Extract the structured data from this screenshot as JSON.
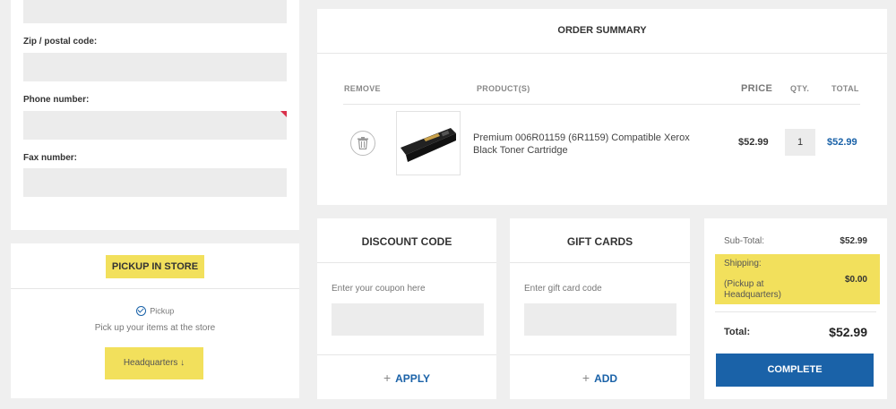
{
  "address_form": {
    "zip_label": "Zip / postal code:",
    "phone_label": "Phone number:",
    "fax_label": "Fax number:"
  },
  "pickup": {
    "title": "PICKUP IN STORE",
    "option_label": "Pickup",
    "description": "Pick up your items at the store",
    "store_button": "Headquarters ↓"
  },
  "order_summary": {
    "title": "ORDER SUMMARY",
    "headers": {
      "remove": "REMOVE",
      "products": "PRODUCT(S)",
      "price": "PRICE",
      "qty": "QTY.",
      "total": "TOTAL"
    },
    "item": {
      "name": "Premium 006R01159 (6R1159) Compatible Xerox Black Toner Cartridge",
      "price": "$52.99",
      "qty": "1",
      "total": "$52.99"
    }
  },
  "discount": {
    "title": "DISCOUNT CODE",
    "placeholder": "Enter your coupon here",
    "action": "APPLY"
  },
  "gift_cards": {
    "title": "GIFT CARDS",
    "placeholder": "Enter gift card code",
    "action": "ADD"
  },
  "totals": {
    "subtotal_label": "Sub-Total:",
    "subtotal_value": "$52.99",
    "shipping_label": "Shipping:",
    "shipping_note": "(Pickup at Headquarters)",
    "shipping_value": "$0.00",
    "total_label": "Total:",
    "total_value": "$52.99",
    "complete_button": "COMPLETE"
  },
  "colors": {
    "accent": "#1a62a8",
    "highlight": "#f2e05c",
    "required": "#d9304a"
  }
}
